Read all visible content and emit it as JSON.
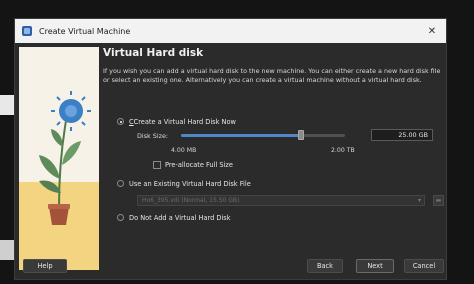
{
  "window": {
    "title": "Create Virtual Machine"
  },
  "page": {
    "title": "Virtual Hard disk",
    "description": "If you wish you can add a virtual hard disk to the new machine. You can either create a new hard disk file or select an existing one. Alternatively you can create a virtual machine without a virtual hard disk."
  },
  "options": {
    "create_new": {
      "label": "Create a Virtual Hard Disk Now",
      "selected": true
    },
    "disk_size_label": "Disk Size:",
    "disk_size_value": "25.00 GB",
    "disk_size_fraction": 0.73,
    "disk_min": "4.00 MB",
    "disk_max": "2.00 TB",
    "preallocate": {
      "label": "Pre-allocate Full Size",
      "checked": false
    },
    "use_existing": {
      "label": "Use an Existing Virtual Hard Disk File",
      "selected": false,
      "file": "Ho6_395.vdi (Normal, 15.50 GB)"
    },
    "no_disk": {
      "label": "Do Not Add a Virtual Hard Disk",
      "selected": false
    }
  },
  "buttons": {
    "help": "Help",
    "back": "Back",
    "next": "Next",
    "cancel": "Cancel"
  },
  "colors": {
    "accent": "#4f87c7",
    "illustration_floor": "#f3d480",
    "flower": "#3b7fc4",
    "leaf": "#5d8b5a",
    "pot": "#a4533a"
  },
  "icons": {
    "app": "virtualbox-icon",
    "close": "close-icon",
    "folder": "folder-icon",
    "dropdown": "chevron-down-icon"
  }
}
